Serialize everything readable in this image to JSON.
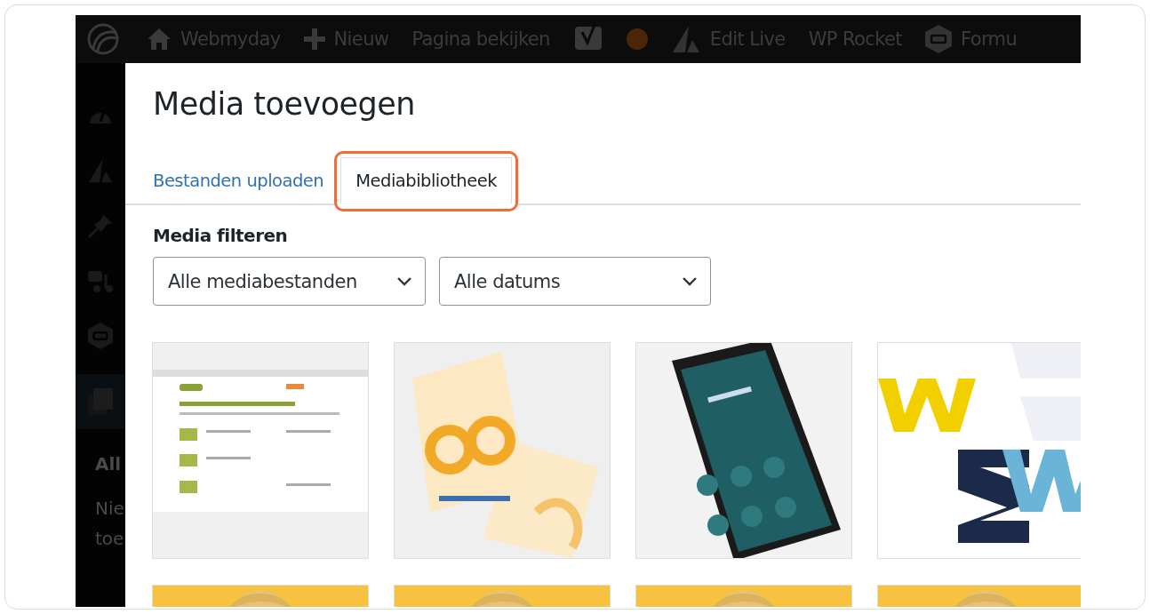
{
  "admin_bar": {
    "items": [
      {
        "kind": "logo"
      },
      {
        "kind": "home",
        "label": "Webmyday"
      },
      {
        "kind": "plus",
        "label": "Nieuw"
      },
      {
        "kind": "text",
        "label": "Pagina bekijken"
      },
      {
        "kind": "shield"
      },
      {
        "kind": "dot"
      },
      {
        "kind": "triangle",
        "label": "Edit Live"
      },
      {
        "kind": "text",
        "label": "WP Rocket"
      },
      {
        "kind": "hexagon",
        "label": "Formu"
      }
    ]
  },
  "sidebar": {
    "icons": [
      {
        "kind": "gauge",
        "selected": false
      },
      {
        "kind": "triangle",
        "selected": false
      },
      {
        "kind": "pin",
        "selected": false
      },
      {
        "kind": "media",
        "selected": false
      },
      {
        "kind": "hexagon",
        "selected": false
      },
      {
        "kind": "pages",
        "selected": true
      }
    ],
    "texts": [
      "All",
      "Nie",
      "toe"
    ]
  },
  "modal": {
    "title": "Media toevoegen",
    "tabs": [
      {
        "label": "Bestanden uploaden",
        "selected": false,
        "highlighted": false
      },
      {
        "label": "Mediabibliotheek",
        "selected": true,
        "highlighted": true
      }
    ],
    "filter_label": "Media filteren",
    "filters": [
      {
        "value": "Alle mediabestanden"
      },
      {
        "value": "Alle datums"
      }
    ]
  }
}
